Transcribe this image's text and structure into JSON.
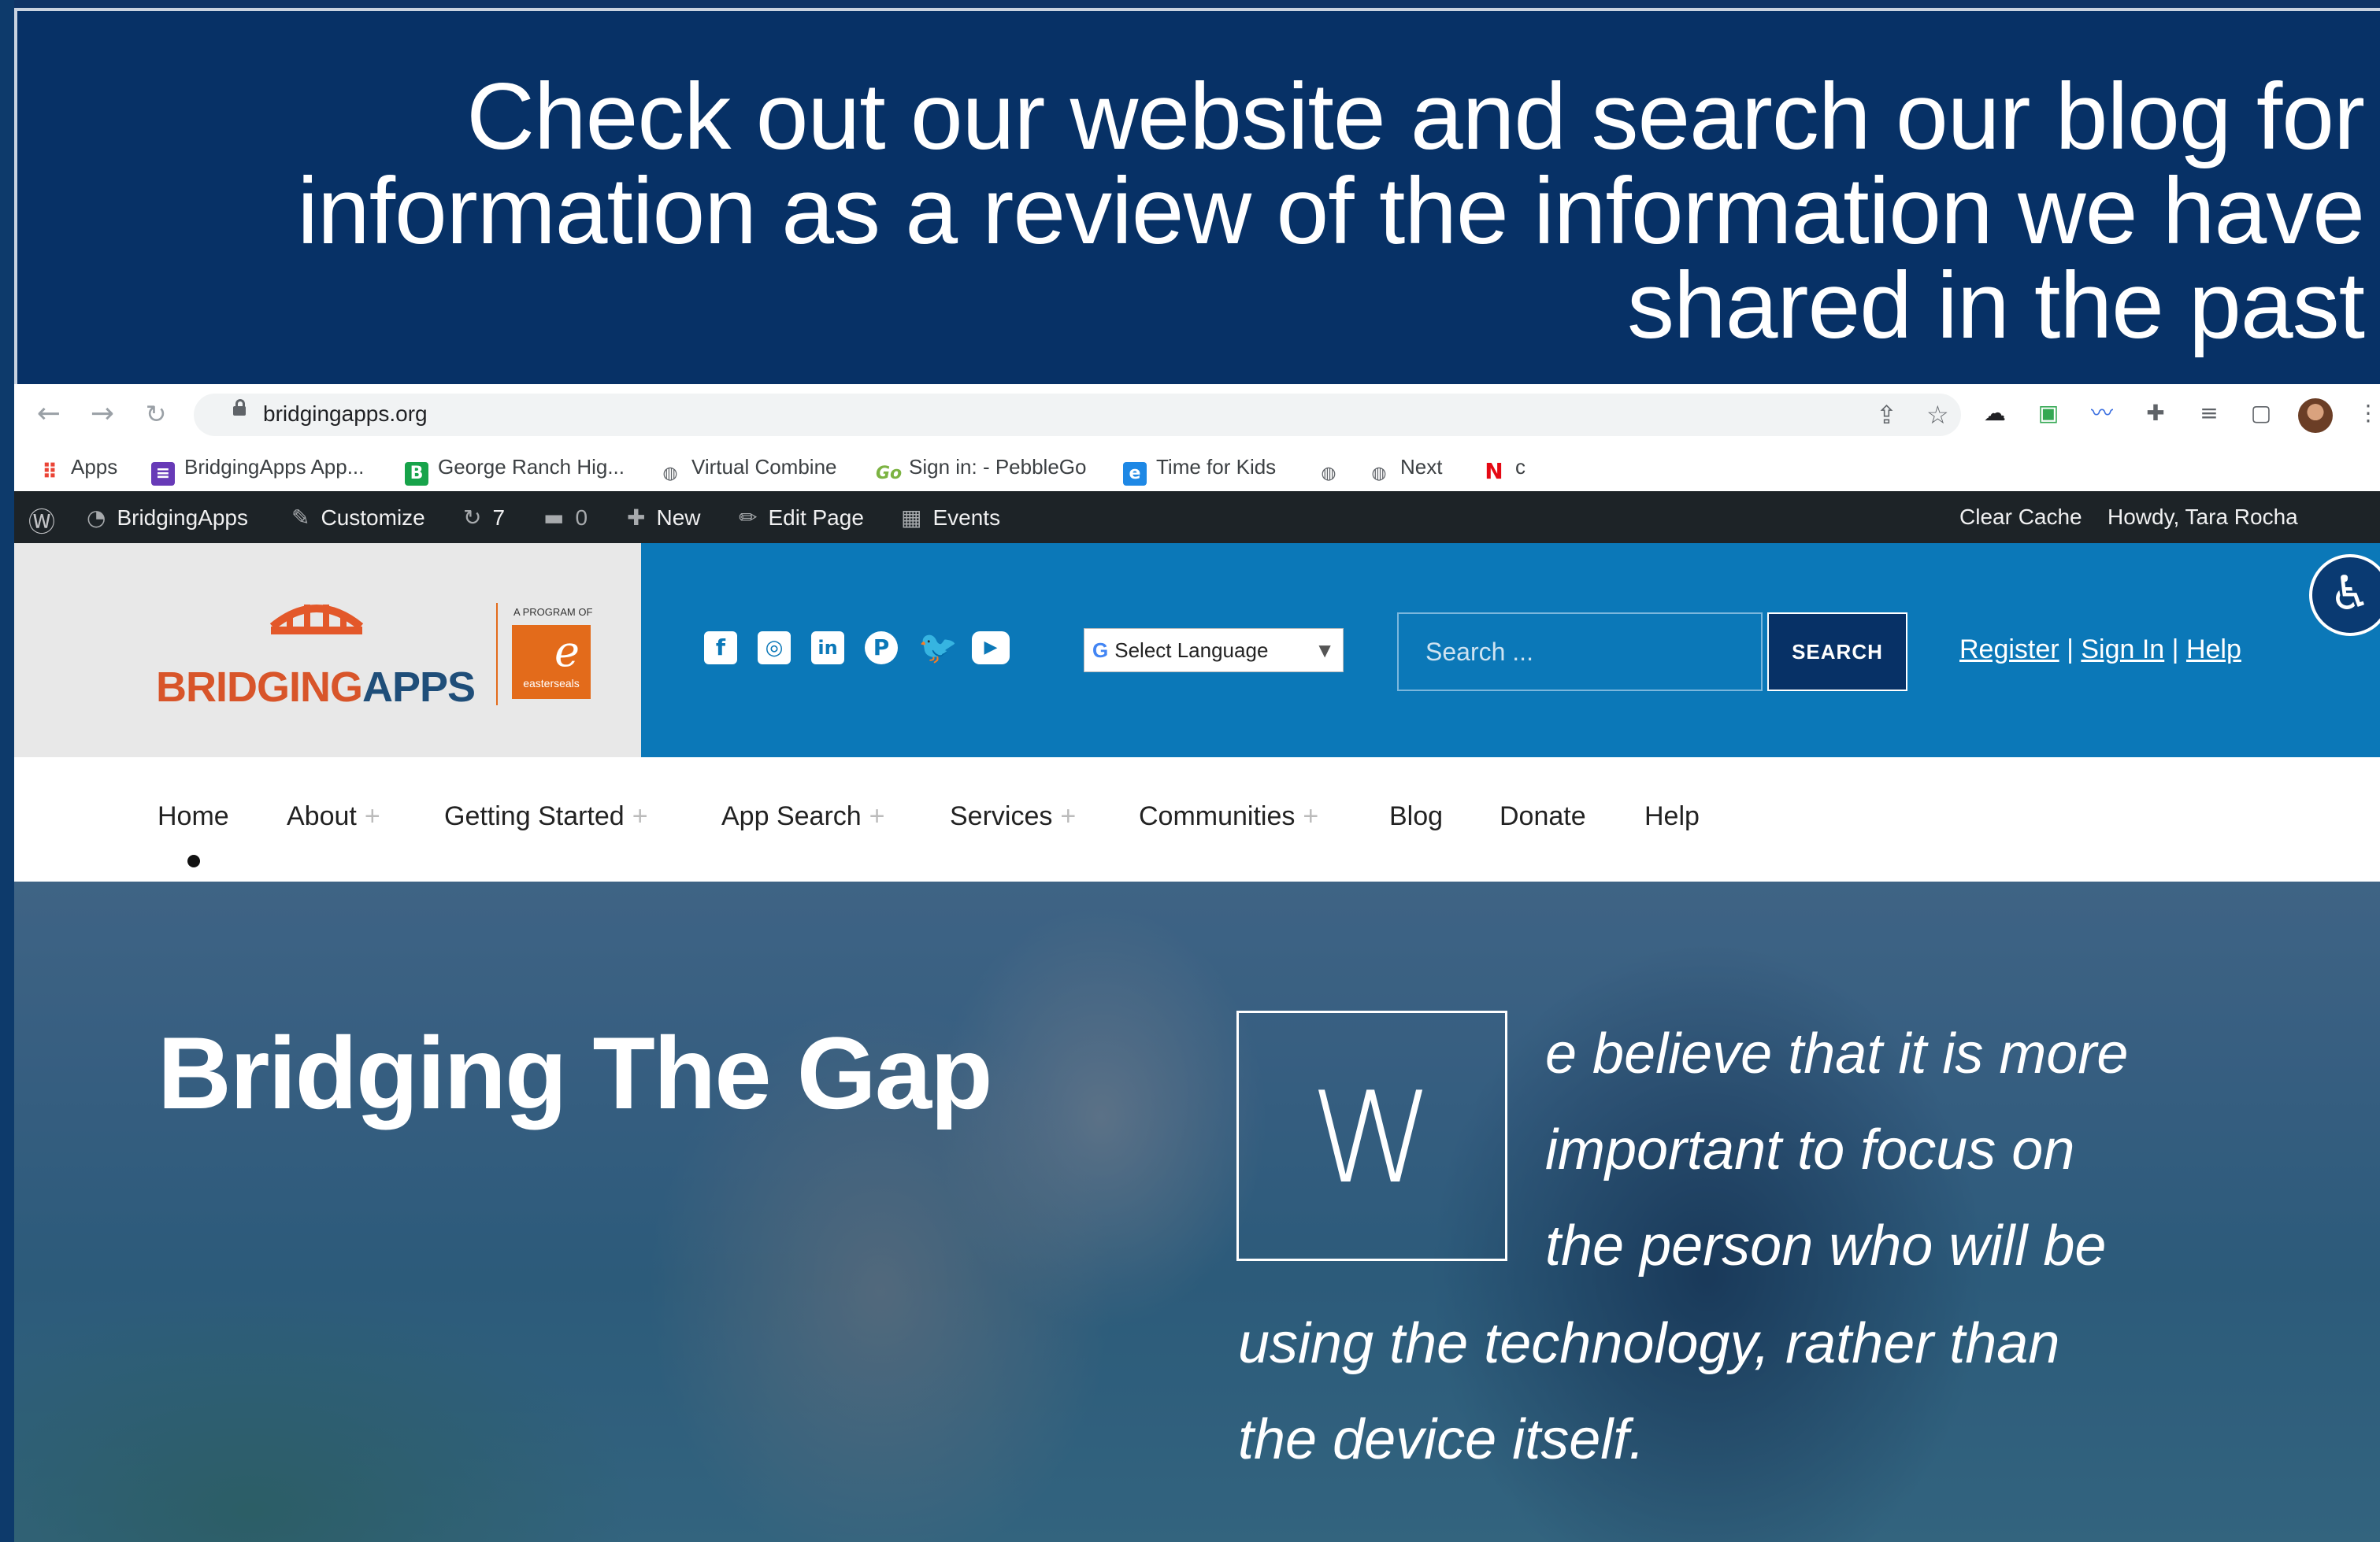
{
  "slide": {
    "title_line1": "Check out our website and search our blog for",
    "title_line2": "information as a review of the information we have",
    "title_line3": "shared in the past"
  },
  "browser": {
    "url": "bridgingapps.org",
    "bookmarks": [
      {
        "label": "Apps",
        "icon": "apps-grid-icon"
      },
      {
        "label": "BridgingApps App...",
        "icon": "form-icon"
      },
      {
        "label": "George Ranch Hig...",
        "icon": "b-icon"
      },
      {
        "label": "Virtual Combine",
        "icon": "globe-icon"
      },
      {
        "label": "Sign in: - PebbleGo",
        "icon": "go-icon"
      },
      {
        "label": "Time for Kids",
        "icon": "e-icon"
      },
      {
        "label": "",
        "icon": "globe-icon"
      },
      {
        "label": "Next",
        "icon": "globe-icon"
      },
      {
        "label": "c",
        "icon": "netflix-icon"
      }
    ]
  },
  "adminbar": {
    "site": "BridgingApps",
    "customize": "Customize",
    "updates": "7",
    "comments": "0",
    "new": "New",
    "edit_page": "Edit Page",
    "events": "Events",
    "clear_cache": "Clear Cache",
    "howdy": "Howdy, Tara Rocha"
  },
  "header": {
    "logo_bridging": "BRIDGING",
    "logo_apps": "APPS",
    "program_label": "A PROGRAM OF",
    "seal_name": "easterseals",
    "language": "Select Language",
    "search_placeholder": "Search ...",
    "search_button": "SEARCH",
    "register": "Register",
    "sign_in": "Sign In",
    "help": "Help",
    "separator": "|"
  },
  "nav": {
    "items": [
      {
        "label": "Home",
        "plus": ""
      },
      {
        "label": "About",
        "plus": "+"
      },
      {
        "label": "Getting Started",
        "plus": "+"
      },
      {
        "label": "App Search",
        "plus": "+"
      },
      {
        "label": "Services",
        "plus": "+"
      },
      {
        "label": "Communities",
        "plus": "+"
      },
      {
        "label": "Blog",
        "plus": ""
      },
      {
        "label": "Donate",
        "plus": ""
      },
      {
        "label": "Help",
        "plus": ""
      }
    ]
  },
  "hero": {
    "title": "Bridging The Gap",
    "dropcap": "W",
    "quote_lines": [
      "e believe that it is more",
      "important to focus on",
      "the person who will be",
      "using the technology, rather than",
      "the device itself."
    ]
  },
  "colors": {
    "banner": "#073166",
    "header_blue": "#0b78b8",
    "brand_orange": "#e36b1b",
    "admin_bar": "#1d2327"
  }
}
